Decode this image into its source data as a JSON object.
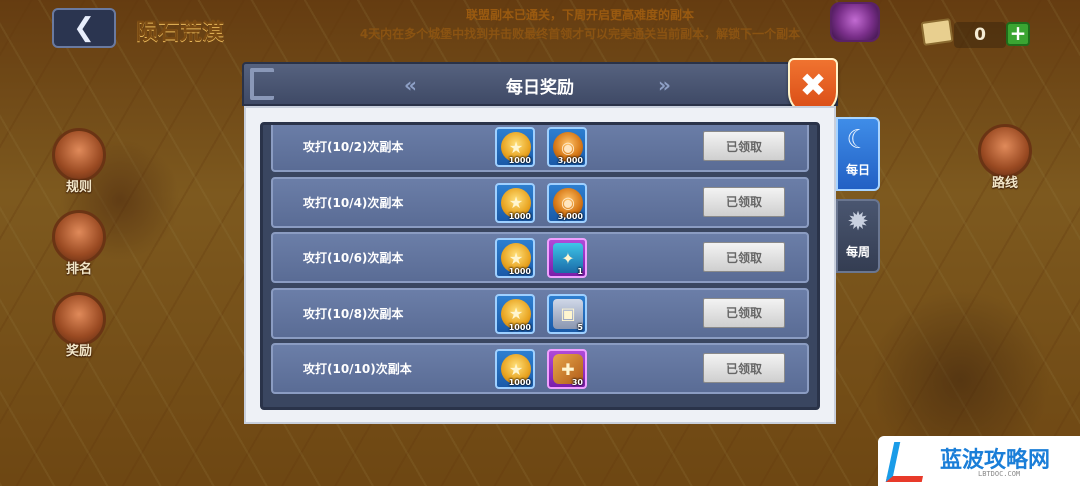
{
  "topbar": {
    "back_label": "❮",
    "stage_title": "陨石荒漠",
    "notice_line1": "联盟副本已通关，下周开启更高难度的副本",
    "notice_line2": "4天内在多个城堡中找到并击败最终首领才可以完美通关当前副本，解锁下一个副本",
    "resource_count": "0",
    "plus_label": "+"
  },
  "side_left": [
    {
      "label": "规则"
    },
    {
      "label": "排名"
    },
    {
      "label": "奖励"
    }
  ],
  "side_right": {
    "route_label": "路线"
  },
  "modal": {
    "title": "每日奖励",
    "arrow_left": "«",
    "arrow_right": "»",
    "close_label": "✖",
    "rows": [
      {
        "label": "攻打(10/2)次副本",
        "rewards": [
          {
            "type": "gold",
            "amount": "1000"
          },
          {
            "type": "coin",
            "amount": "3,000"
          }
        ],
        "status": "已领取"
      },
      {
        "label": "攻打(10/4)次副本",
        "rewards": [
          {
            "type": "gold",
            "amount": "1000"
          },
          {
            "type": "coin",
            "amount": "3,000"
          }
        ],
        "status": "已领取"
      },
      {
        "label": "攻打(10/6)次副本",
        "rewards": [
          {
            "type": "gold",
            "amount": "1000"
          },
          {
            "type": "card",
            "amount": "1"
          }
        ],
        "status": "已领取"
      },
      {
        "label": "攻打(10/8)次副本",
        "rewards": [
          {
            "type": "gold",
            "amount": "1000"
          },
          {
            "type": "chest",
            "amount": "5"
          }
        ],
        "status": "已领取"
      },
      {
        "label": "攻打(10/10)次副本",
        "rewards": [
          {
            "type": "gold",
            "amount": "1000"
          },
          {
            "type": "scroll",
            "amount": "30"
          }
        ],
        "status": "已领取"
      }
    ]
  },
  "tabs": {
    "daily": {
      "label": "每日",
      "icon": "sun-moon-icon"
    },
    "weekly": {
      "label": "每周",
      "icon": "sun-icon"
    }
  },
  "watermark": {
    "name": "蓝波攻略网",
    "url": "LBTDOC.COM"
  }
}
